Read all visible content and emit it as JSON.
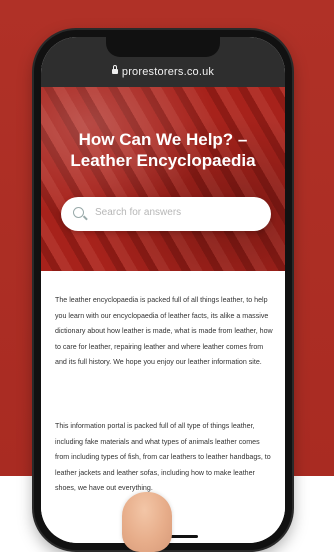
{
  "browser": {
    "url": "prorestorers.co.uk"
  },
  "hero": {
    "title": "How Can We Help? – Leather Encyclopaedia",
    "search_placeholder": "Search for answers"
  },
  "content": {
    "paragraphs": [
      "The leather encyclopaedia is packed full of all things leather, to help you learn with our encyclopaedia of leather facts, its alike a massive dictionary about how leather is made, what is made from leather, how to care for leather, repairing leather and where leather comes from and its full history. We hope you enjoy our leather information site.",
      "This information portal is packed full of all type of things leather, including fake materials and what types of animals leather comes from including types of fish, from car leathers to leather handbags, to leather jackets and leather sofas, including how to make leather shoes, we have out everything."
    ]
  },
  "colors": {
    "brand_red": "#b03127",
    "url_bar": "#2e2e2e"
  }
}
